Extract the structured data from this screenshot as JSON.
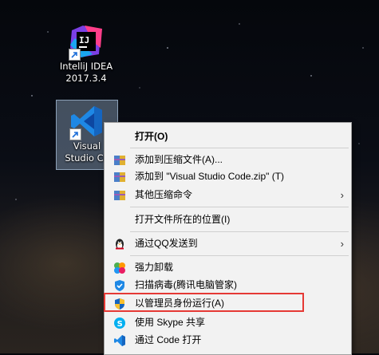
{
  "desktop": {
    "icons": [
      {
        "label_line1": "IntelliJ IDEA",
        "label_line2": "2017.3.4",
        "icon": "intellij-idea-icon"
      },
      {
        "label_line1": "Visual",
        "label_line2": "Studio Co",
        "icon": "vscode-icon"
      }
    ]
  },
  "menu": {
    "items": [
      {
        "label": "打开(O)",
        "icon": "none",
        "bold": true
      },
      {
        "label": "添加到压缩文件(A)...",
        "icon": "archive-icon"
      },
      {
        "label": "添加到 \"Visual Studio Code.zip\" (T)",
        "icon": "archive-icon"
      },
      {
        "label": "其他压缩命令",
        "icon": "archive-icon",
        "submenu": true
      },
      {
        "label": "打开文件所在的位置(I)",
        "icon": "none"
      },
      {
        "label": "通过QQ发送到",
        "icon": "qq-penguin-icon",
        "submenu": true
      },
      {
        "label": "强力卸载",
        "icon": "pinwheel-icon"
      },
      {
        "label": "扫描病毒(腾讯电脑管家)",
        "icon": "shield-icon"
      },
      {
        "label": "以管理员身份运行(A)",
        "icon": "uac-shield-icon"
      },
      {
        "label": "使用 Skype 共享",
        "icon": "skype-icon"
      },
      {
        "label": "通过 Code 打开",
        "icon": "vscode-icon"
      }
    ],
    "submenu_arrow": "›",
    "colors": {
      "highlight": "#e53935",
      "menu_bg": "#f2f2f2"
    }
  }
}
